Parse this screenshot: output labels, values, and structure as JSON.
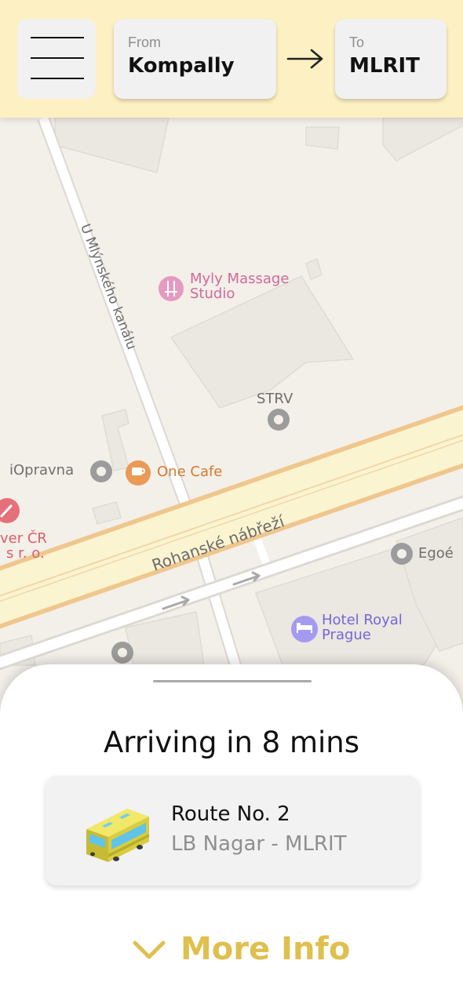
{
  "header": {
    "from_caption": "From",
    "from_value": "Kompally",
    "to_caption": "To",
    "to_value": "MLRIT"
  },
  "map": {
    "street_u_mlynskeho": "U Mlýnského kanálu",
    "street_rohanske": "Rohanské nábřeží",
    "poi_massage_line1": "Myly Massage",
    "poi_massage_line2": "Studio",
    "poi_strv": "STRV",
    "poi_iopravna": "iOpravna",
    "poi_one_cafe": "One Cafe",
    "poi_ver_line1": "ver ČR",
    "poi_ver_line2": "s r. o.",
    "poi_egoe": "Egoé",
    "poi_hotel_line1": "Hotel Royal",
    "poi_hotel_line2": "Prague"
  },
  "sheet": {
    "arriving_text": "Arriving in 8 mins",
    "route_name": "Route No. 2",
    "route_path": "LB Nagar - MLRIT",
    "more_info_label": "More Info"
  },
  "colors": {
    "header_bg": "#fdf0c2",
    "accent_gold": "#dfc04e",
    "map_bg": "#f3efe9",
    "road_yellow": "#fbf4d0",
    "road_border_orange": "#efc78d"
  },
  "icons": {
    "menu": "hamburger-menu-icon",
    "arrow": "arrow-right-icon",
    "bus": "bus-icon",
    "chevron": "chevron-down-icon"
  }
}
